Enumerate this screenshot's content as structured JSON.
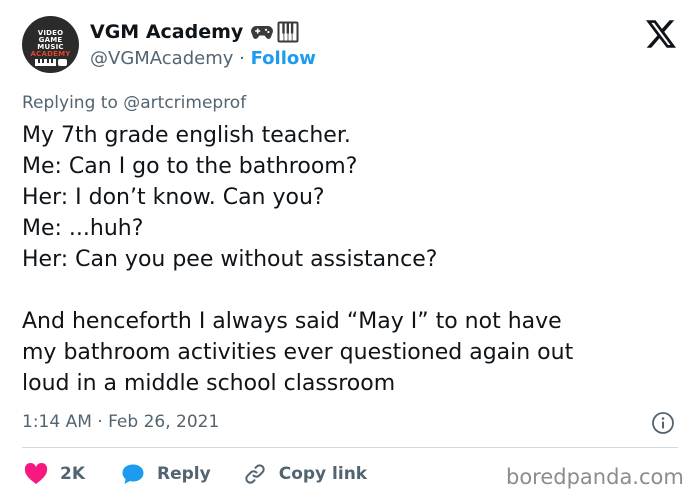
{
  "author": {
    "display_name": "VGM Academy",
    "handle": "@VGMAcademy",
    "separator": "·",
    "follow_label": "Follow",
    "avatar_text": [
      "VIDEO",
      "GAME",
      "MUSIC",
      "ACADEMY"
    ]
  },
  "reply_context": {
    "prefix": "Replying to",
    "mention": "@artcrimeprof"
  },
  "tweet": {
    "lines": [
      "My 7th grade english teacher.",
      "Me: Can I go to the bathroom?",
      "Her: I don’t know. Can you?",
      "Me: ...huh?",
      "Her: Can you pee without assistance?",
      "",
      "And henceforth I always said “May I” to not have",
      "my bathroom activities ever questioned again out",
      "loud in a middle school classroom"
    ]
  },
  "meta": {
    "timestamp": "1:14 AM · Feb 26, 2021"
  },
  "actions": {
    "likes": "2K",
    "reply_label": "Reply",
    "copy_link_label": "Copy link"
  },
  "watermark": "boredpanda.com",
  "colors": {
    "accent": "#1d9bf0",
    "heart": "#f91880",
    "muted": "#536471"
  },
  "icons": [
    "x-logo-icon",
    "gamepad-icon",
    "piano-icon",
    "info-icon",
    "heart-icon",
    "reply-bubble-icon",
    "link-icon"
  ]
}
